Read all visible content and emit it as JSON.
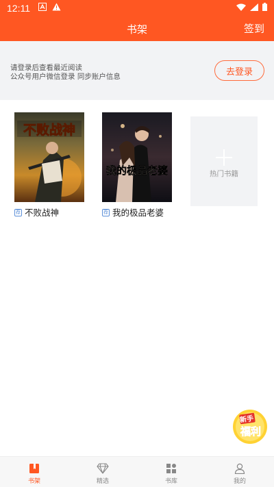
{
  "status_bar": {
    "time": "12:11",
    "left_icons": [
      "a-icon",
      "warning-icon"
    ],
    "right_icons": [
      "wifi-icon",
      "signal-icon",
      "battery-icon"
    ]
  },
  "header": {
    "title": "书架",
    "checkin_label": "签到"
  },
  "login_banner": {
    "line1": "请登录后查看最近阅读",
    "line2": "公众号用户微信登录 同步账户信息",
    "button_label": "去登录"
  },
  "books": [
    {
      "title": "不败战神",
      "cover_text": "不败战神",
      "tag": "荐"
    },
    {
      "title": "我的极品老婆",
      "cover_text": "我的极品老婆",
      "tag": "荐"
    }
  ],
  "hot_books": {
    "label": "热门书籍"
  },
  "welfare_badge": {
    "line1": "新手",
    "line2": "福利"
  },
  "bottom_nav": {
    "items": [
      {
        "label": "书架",
        "icon": "bookshelf-icon",
        "active": true
      },
      {
        "label": "精选",
        "icon": "diamond-icon",
        "active": false
      },
      {
        "label": "书库",
        "icon": "grid-icon",
        "active": false
      },
      {
        "label": "我的",
        "icon": "person-icon",
        "active": false
      }
    ]
  },
  "colors": {
    "accent": "#ff5722",
    "banner_bg": "#f2f3f5",
    "tag_blue": "#5b8fd8"
  }
}
